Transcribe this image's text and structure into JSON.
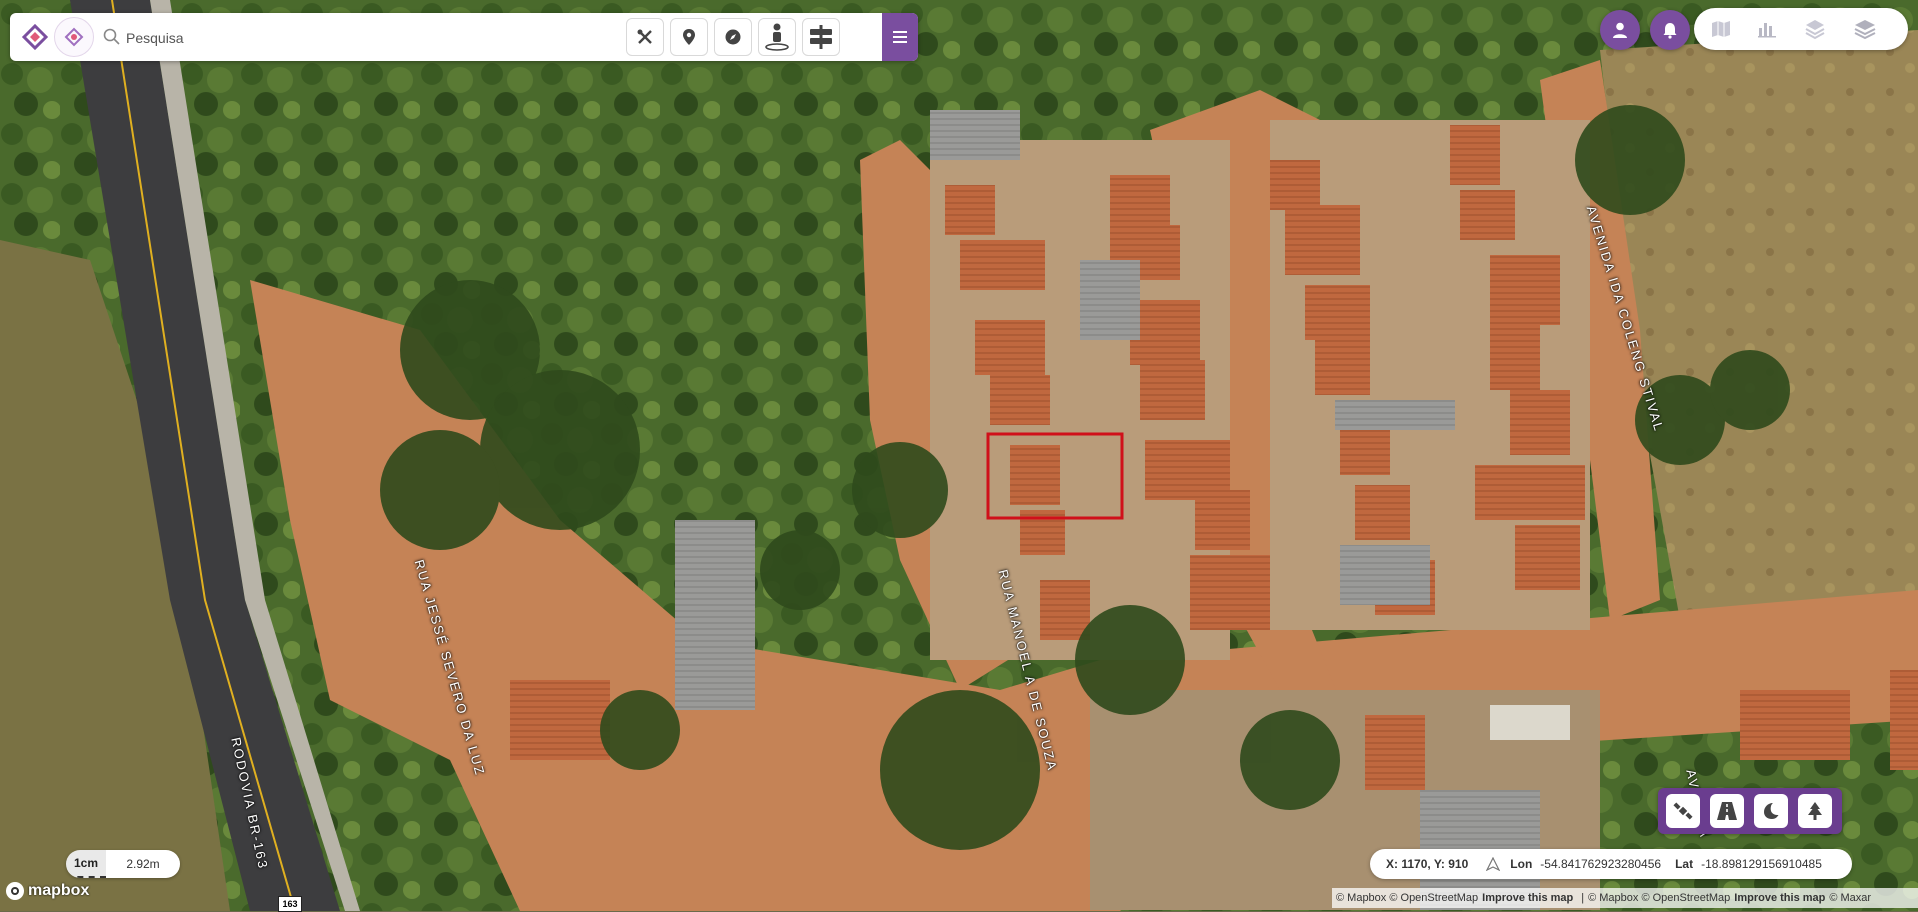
{
  "search": {
    "placeholder": "Pesquisa"
  },
  "toolbar": {
    "icons": [
      "tools-icon",
      "location-pin-icon",
      "compass-icon",
      "street-view-icon",
      "signpost-icon"
    ],
    "menu_icon": "hamburger-menu-icon"
  },
  "top_right": {
    "user_icon": "user-icon",
    "notifications_icon": "bell-icon",
    "layers": [
      "map-icon",
      "chart-icon",
      "layers-icon",
      "stack-icon"
    ]
  },
  "bottom_tools": [
    "satellite-icon",
    "road-icon",
    "moon-icon",
    "tree-icon"
  ],
  "coordinates": {
    "xy": "X: 1170, Y: 910",
    "lon_label": "Lon",
    "lon_value": "-54.841762923280456",
    "lat_label": "Lat",
    "lat_value": "-18.898129156910485"
  },
  "scale": {
    "unit": "1cm",
    "value": "2.92m"
  },
  "mapbox_logo": "mapbox",
  "attribution": {
    "part1": "© Mapbox © OpenStreetMap",
    "improve1": "Improve this map",
    "sep": "|",
    "part2": "© Mapbox © OpenStreetMap",
    "improve2": "Improve this map",
    "maxar": "© Maxar"
  },
  "highway_shield": "163",
  "streets": {
    "rodovia": "RODOVIA BR-163",
    "jesse": "RUA JESSÉ SEVERO DA LUZ",
    "manoel": "RUA MANOEL A DE SOUZA",
    "avenida": "AVENIDA IDA COLENG STIVAL",
    "avenida2": "AVENIDA"
  },
  "colors": {
    "accent": "#7a4e9f",
    "selection": "#d0101a",
    "dirt": "#c58356",
    "vegetation": "#3f5a26",
    "roof": "#c0683f"
  }
}
